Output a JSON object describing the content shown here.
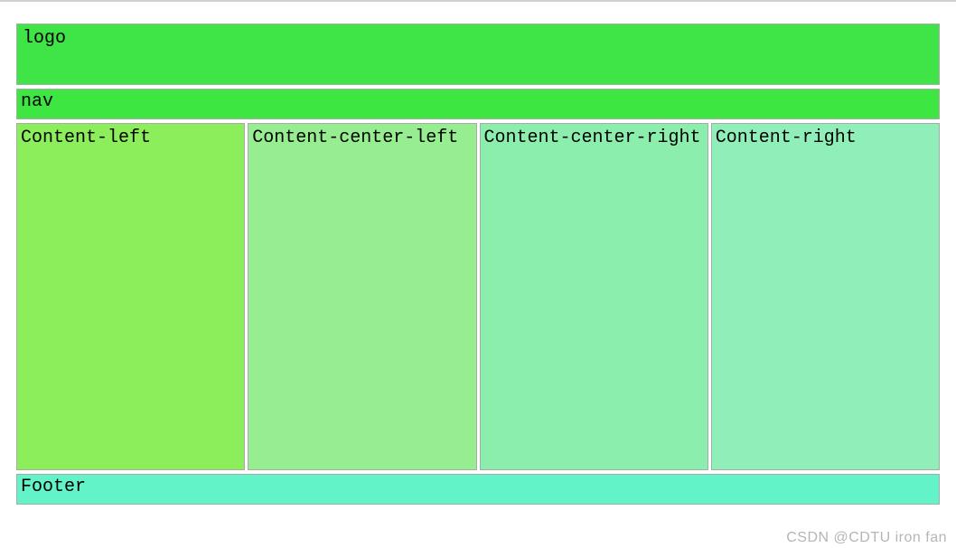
{
  "header": {
    "logo_text": "logo"
  },
  "nav": {
    "label": "nav"
  },
  "content": {
    "columns": [
      {
        "label": "Content-left"
      },
      {
        "label": "Content-center-left"
      },
      {
        "label": "Content-center-right"
      },
      {
        "label": "Content-right"
      }
    ]
  },
  "footer": {
    "label": "Footer"
  },
  "watermark": {
    "text": "CSDN @CDTU iron fan"
  },
  "colors": {
    "header_bg": "#3fe447",
    "nav_bg": "#3de640",
    "col1_bg": "#8cee5a",
    "col2_bg": "#96ee90",
    "col3_bg": "#8ceeac",
    "col4_bg": "#90eeb9",
    "footer_bg": "#62f3c9"
  }
}
